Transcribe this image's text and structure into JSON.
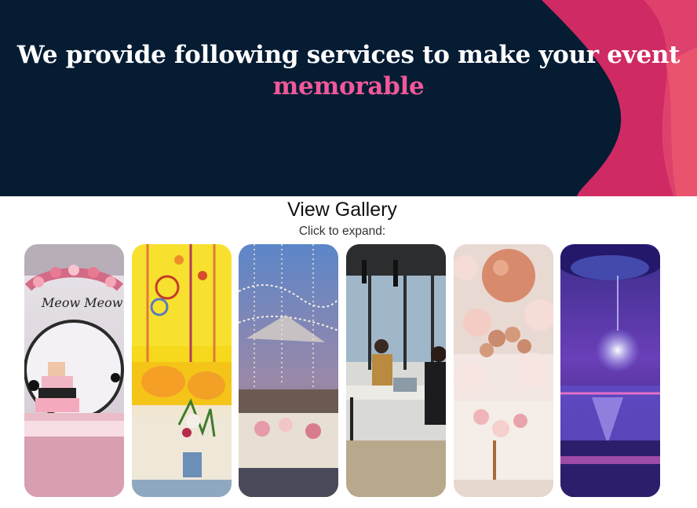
{
  "hero": {
    "title_main": "We provide following services to make your event",
    "title_accent": "memorable",
    "colors": {
      "background": "#051c33",
      "accent": "#f0589a",
      "wave": "#cf2a63"
    }
  },
  "gallery": {
    "title": "View Gallery",
    "subtitle": "Click to expand:",
    "cards": [
      {
        "image": "cat-themed-birthday-cake-table",
        "backdrop_text": "Meow Meow"
      },
      {
        "image": "yellow-floral-dreamcatcher-decor"
      },
      {
        "image": "outdoor-dinner-hanging-lights"
      },
      {
        "image": "modern-coworking-office"
      },
      {
        "image": "pink-balloon-table-setup"
      },
      {
        "image": "purple-chandelier-ballroom"
      }
    ]
  }
}
